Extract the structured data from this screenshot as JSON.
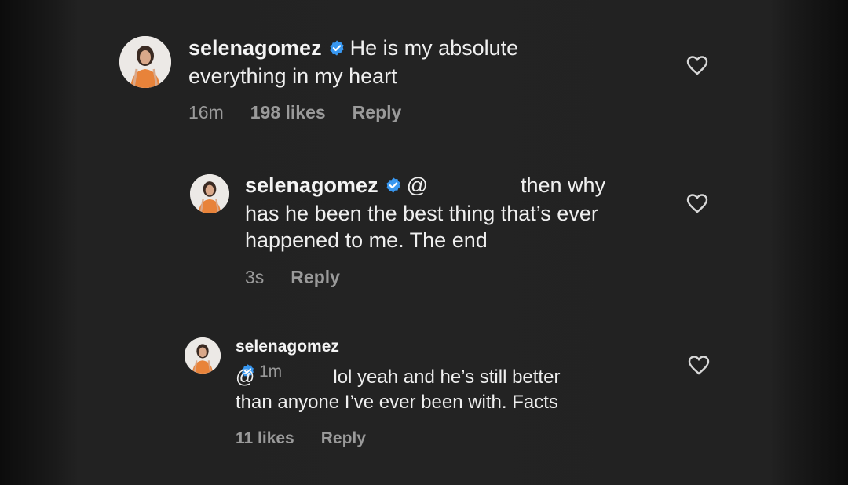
{
  "comments": [
    {
      "username": "selenagomez",
      "text_line1": "He is my absolute",
      "text_line2": "everything in my heart",
      "time": "16m",
      "likes": "198 likes",
      "reply": "Reply"
    },
    {
      "username": "selenagomez",
      "mention": "@",
      "text_line1": "then why",
      "text_line2": "has he been the best thing that’s ever",
      "text_line3": "happened to me. The end",
      "time": "3s",
      "reply": "Reply"
    },
    {
      "username": "selenagomez",
      "time": "1m",
      "mention": "@",
      "text_line1": "lol yeah and he’s still better",
      "text_line2": "than anyone I’ve ever been with. Facts",
      "likes": "11 likes",
      "reply": "Reply"
    }
  ],
  "colors": {
    "background": "#232323",
    "verified_badge": "#3897f0",
    "meta_text": "#9a9a9a",
    "avatar_dress": "#e8833a"
  },
  "icons": {
    "verified": "verified-badge-icon",
    "like": "heart-outline-icon"
  }
}
